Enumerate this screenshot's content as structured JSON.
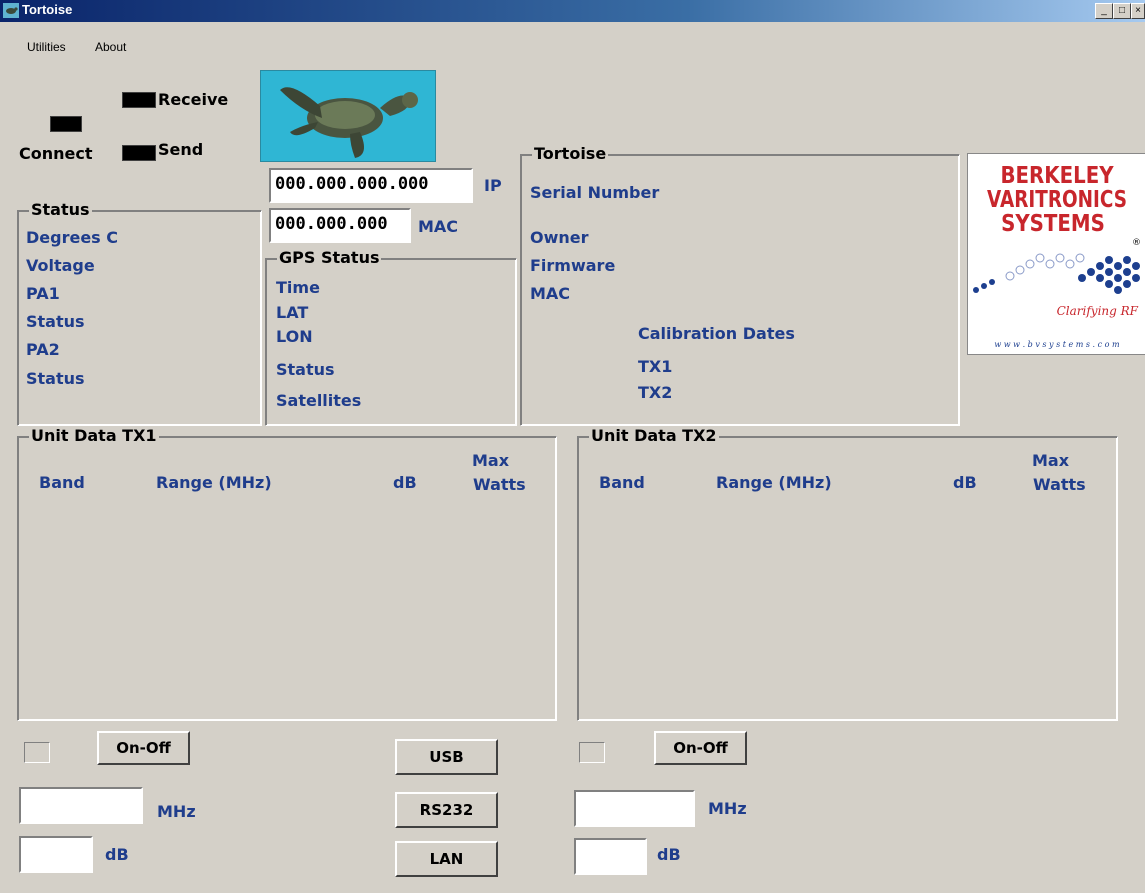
{
  "window": {
    "title": "Tortoise",
    "min": "_",
    "max": "□",
    "close": "×"
  },
  "menu": {
    "utilities": "Utilities",
    "about": "About"
  },
  "indicators": {
    "receive": "Receive",
    "connect": "Connect",
    "send": "Send"
  },
  "network": {
    "ip_value": "000.000.000.000",
    "ip_label": "IP",
    "mac_value": "000.000.000",
    "mac_label": "MAC"
  },
  "status": {
    "title": "Status",
    "rows": [
      "Degrees C",
      "Voltage",
      "PA1",
      "Status",
      "PA2",
      "Status"
    ]
  },
  "gps": {
    "title": "GPS Status",
    "rows": [
      "Time",
      "LAT",
      "LON",
      "Status",
      "Satellites"
    ]
  },
  "tortoise": {
    "title": "Tortoise",
    "serial": "Serial Number",
    "owner": "Owner",
    "firmware": "Firmware",
    "mac": "MAC",
    "cal_title": "Calibration Dates",
    "tx1": "TX1",
    "tx2": "TX2"
  },
  "logo": {
    "line1": "BERKELEY",
    "line2": "VARITRONICS",
    "line3": "SYSTEMS",
    "reg": "®",
    "tagline": "Clarifying RF",
    "url": "w w w . b v s y s t e m s . c o m"
  },
  "tx1": {
    "title": "Unit Data TX1",
    "band": "Band",
    "range": "Range (MHz)",
    "db": "dB",
    "max": "Max",
    "watts": "Watts",
    "onoff": "On-Off",
    "mhz": "MHz",
    "db_unit": "dB"
  },
  "tx2": {
    "title": "Unit Data TX2",
    "band": "Band",
    "range": "Range (MHz)",
    "db": "dB",
    "max": "Max",
    "watts": "Watts",
    "onoff": "On-Off",
    "mhz": "MHz",
    "db_unit": "dB"
  },
  "interfaces": {
    "usb": "USB",
    "rs232": "RS232",
    "lan": "LAN"
  },
  "colors": {
    "titlebar": "#0a246a",
    "label_blue": "#1f3d8c",
    "led": "#000000",
    "face": "#d4d0c8"
  }
}
